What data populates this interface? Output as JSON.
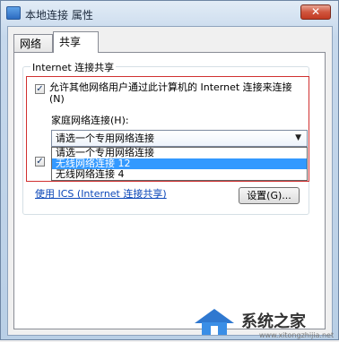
{
  "window": {
    "title": "本地连接 属性",
    "close_glyph": "✕"
  },
  "tabs": [
    {
      "label": "网络",
      "active": false
    },
    {
      "label": "共享",
      "active": true
    }
  ],
  "sharing": {
    "group_title": "Internet 连接共享",
    "allow_checkbox": {
      "checked": true,
      "label": "允许其他网络用户通过此计算机的 Internet 连接来连接(N)"
    },
    "home_network_label": "家庭网络连接(H):",
    "home_network_select": {
      "value": "请选一个专用网络连接",
      "options": [
        "请选一个专用网络连接",
        "无线网络连接 12",
        "无线网络连接 4"
      ],
      "highlighted_index": 1
    },
    "second_checkbox": {
      "checked": true
    },
    "ics_link": "使用 ICS (Internet 连接共享)",
    "settings_button": "设置(G)..."
  },
  "watermark": {
    "text": "系统之家",
    "url": "www.xitongzhijia.net"
  },
  "colors": {
    "selection": "#3399ff",
    "highlight_border": "#d03030",
    "link": "#0a46b8"
  }
}
